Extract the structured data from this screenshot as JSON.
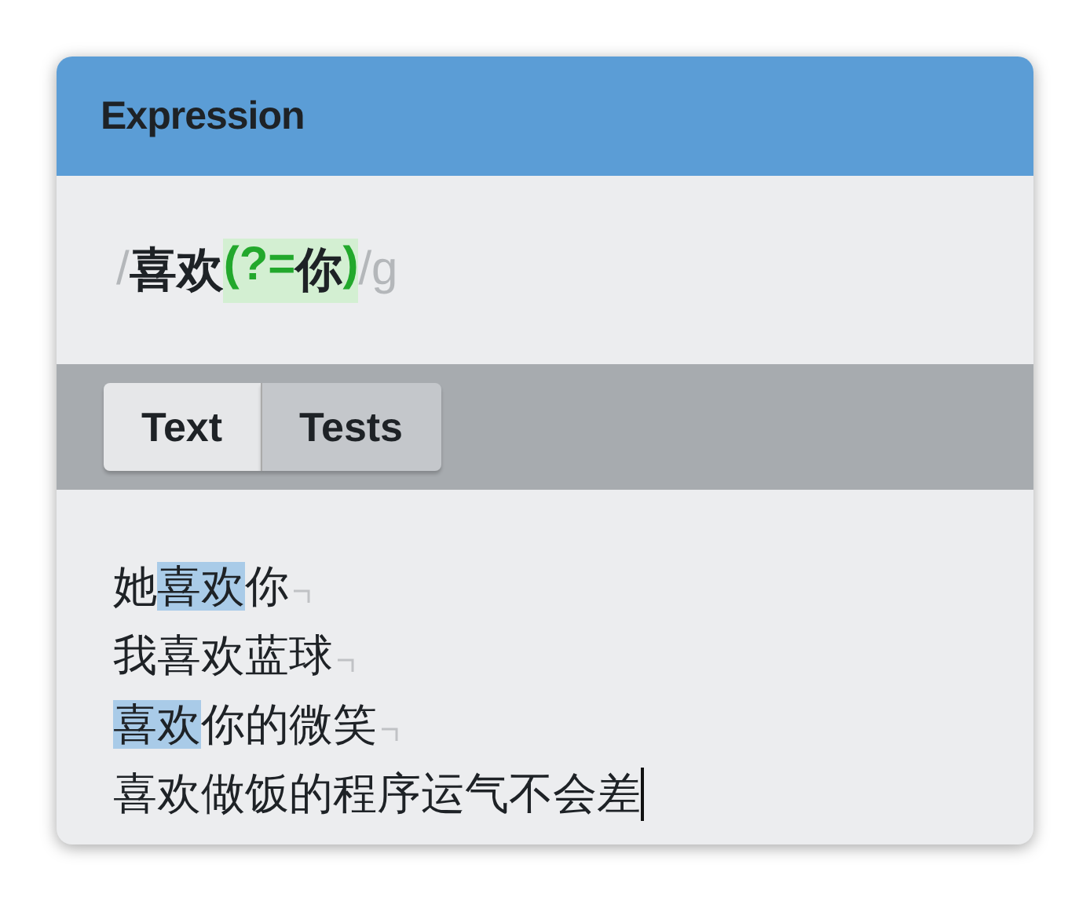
{
  "panel": {
    "title": "Expression"
  },
  "expression": [
    {
      "kind": "delimiter",
      "text": "/"
    },
    {
      "kind": "literal",
      "text": "喜欢"
    },
    {
      "kind": "group",
      "parts": [
        {
          "kind": "paren",
          "text": "("
        },
        {
          "kind": "operator",
          "text": "?="
        },
        {
          "kind": "literal",
          "text": "你"
        },
        {
          "kind": "paren",
          "text": ")"
        }
      ]
    },
    {
      "kind": "delimiter",
      "text": "/"
    },
    {
      "kind": "flags",
      "text": "g"
    }
  ],
  "tabs": [
    {
      "label": "Text",
      "selected": true
    },
    {
      "label": "Tests",
      "selected": false
    }
  ],
  "lines": [
    {
      "kind": "newline",
      "segments": [
        {
          "text": "她",
          "match": false
        },
        {
          "text": "喜欢",
          "match": true
        },
        {
          "text": "你",
          "match": false
        }
      ]
    },
    {
      "kind": "newline",
      "segments": [
        {
          "text": "我喜欢蓝球",
          "match": false
        }
      ]
    },
    {
      "kind": "newline",
      "segments": [
        {
          "text": "喜欢",
          "match": true
        },
        {
          "text": "你的微笑",
          "match": false
        }
      ]
    },
    {
      "kind": "cursor",
      "segments": [
        {
          "text": "喜欢做饭的程序运气不会差",
          "match": false
        }
      ]
    }
  ]
}
